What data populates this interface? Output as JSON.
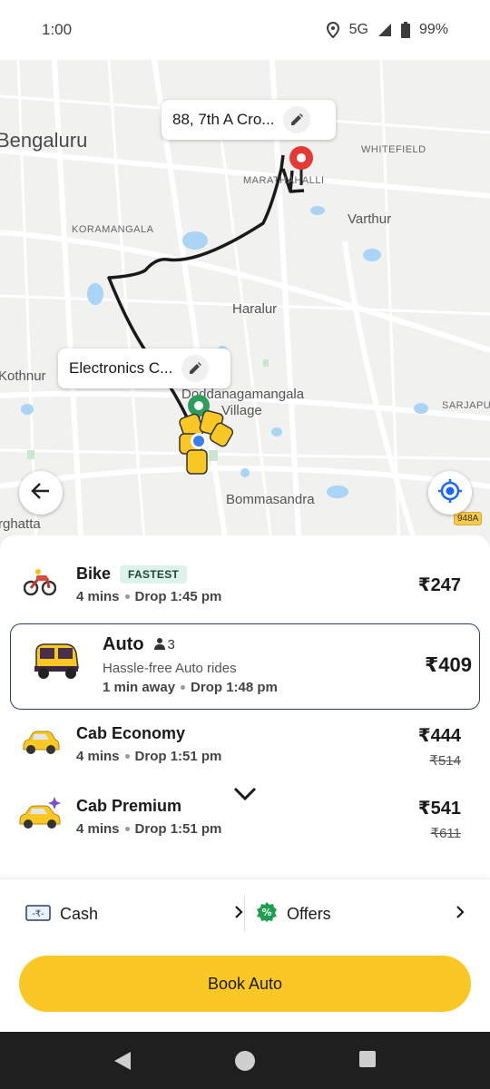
{
  "status": {
    "time": "1:00",
    "network": "5G",
    "battery": "99%"
  },
  "map": {
    "labels": {
      "bengaluru": "Bengaluru",
      "whitefield": "WHITEFIELD",
      "marathahalli": "MARATHAHALLI",
      "varthur": "Varthur",
      "koramangala": "KORAMANGALA",
      "haralur": "Haralur",
      "kothnur": "Kothnur",
      "doddanagamangala": "Doddanagamangala",
      "village": "Village",
      "sarjapur": "SARJAPUR",
      "bommasandra": "Bommasandra",
      "bannerghatta": "rghatta",
      "road_948a": "948A"
    },
    "drop_callout": "88, 7th A Cro...",
    "pickup_callout": "Electronics C..."
  },
  "rides": [
    {
      "name": "Bike",
      "badge": "FASTEST",
      "eta": "4 mins",
      "drop": "Drop 1:45 pm",
      "price": "₹247",
      "icon": "bike-icon"
    },
    {
      "name": "Auto",
      "seats": "3",
      "description": "Hassle-free Auto rides",
      "eta": "1 min away",
      "drop": "Drop 1:48 pm",
      "price": "₹409",
      "icon": "auto-rickshaw-icon",
      "selected": true
    },
    {
      "name": "Cab Economy",
      "eta": "4 mins",
      "drop": "Drop 1:51 pm",
      "price": "₹444",
      "old_price": "₹514",
      "icon": "car-icon"
    },
    {
      "name": "Cab Premium",
      "eta": "4 mins",
      "drop": "Drop 1:51 pm",
      "price": "₹541",
      "old_price": "₹611",
      "icon": "premium-car-icon"
    }
  ],
  "payment": {
    "method": "Cash",
    "offers": "Offers"
  },
  "book_button": "Book Auto",
  "colors": {
    "accent": "#f9c825",
    "selected_border": "#2a3e63",
    "route": "#1a1a1a",
    "drop_pin": "#e53935",
    "pickup_pin": "#2e9e5b"
  }
}
